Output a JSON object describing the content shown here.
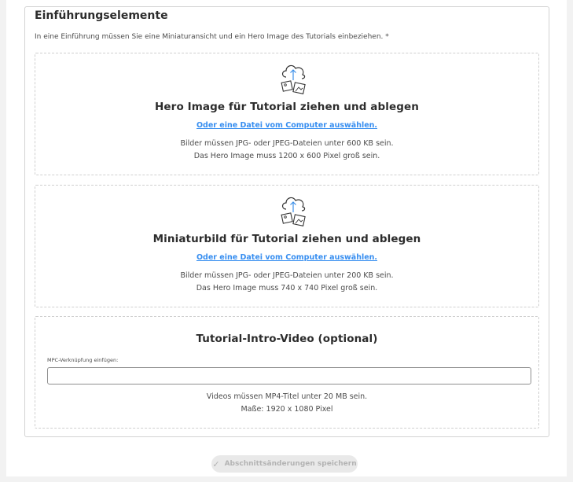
{
  "section": {
    "title": "Einführungselemente",
    "description": "In eine Einführung müssen Sie eine Miniaturansicht und ein Hero Image des Tutorials einbeziehen. *"
  },
  "hero_dropzone": {
    "icon": "cloud-upload-icon",
    "heading": "Hero Image für Tutorial ziehen und ablegen",
    "link": "Oder eine Datei vom Computer auswählen.",
    "note_line1": "Bilder müssen JPG- oder JPEG-Dateien unter 600 KB sein.",
    "note_line2": "Das Hero Image muss 1200 x 600 Pixel groß sein."
  },
  "thumbnail_dropzone": {
    "icon": "cloud-upload-icon",
    "heading": "Miniaturbild für Tutorial ziehen und ablegen",
    "link": "Oder eine Datei vom Computer auswählen.",
    "note_line1": "Bilder müssen JPG- oder JPEG-Dateien unter 200 KB sein.",
    "note_line2": "Das Hero Image muss 740 x 740 Pixel groß sein."
  },
  "video_dropzone": {
    "heading": "Tutorial-Intro-Video (optional)",
    "field_label": "MPC-Verknüpfung einfügen:",
    "field_value": "",
    "note_line1": "Videos müssen MP4-Titel unter 20 MB sein.",
    "note_line2": "Maße: 1920 x 1080 Pixel"
  },
  "footer": {
    "save_label": "Abschnittsänderungen speichern",
    "save_icon": "checkmark-icon",
    "save_enabled": false
  },
  "colors": {
    "link": "#378ef0",
    "text": "#2c2c2c",
    "button_disabled_bg": "#e9e9e9",
    "button_disabled_text": "#b3b3b3"
  }
}
